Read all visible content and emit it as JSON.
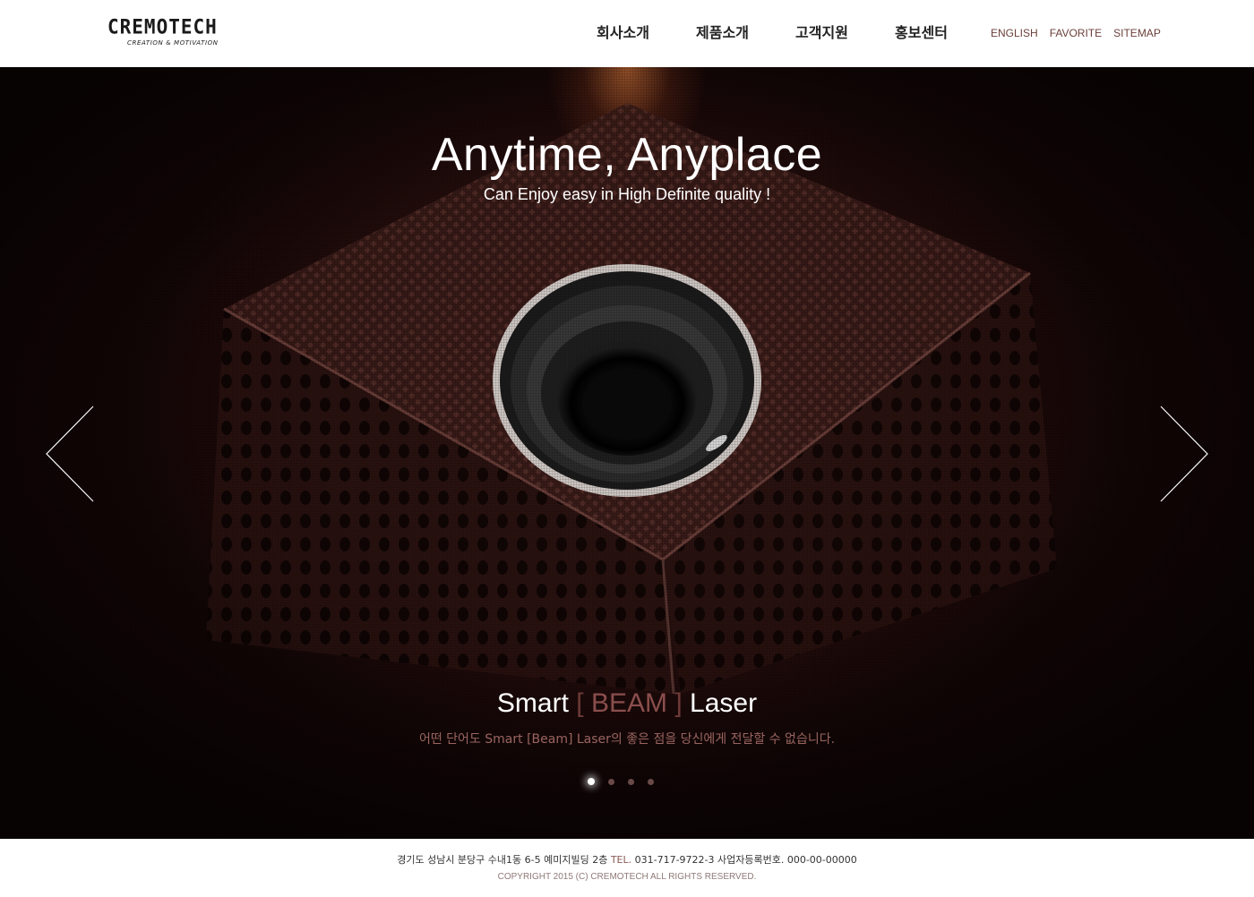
{
  "header": {
    "logo": {
      "main": "CREMOTECH",
      "tagline": "CREATION & MOTIVATION"
    },
    "nav": [
      {
        "label": "회사소개"
      },
      {
        "label": "제품소개"
      },
      {
        "label": "고객지원"
      },
      {
        "label": "홍보센터"
      }
    ],
    "util": [
      {
        "label": "ENGLISH"
      },
      {
        "label": "FAVORITE"
      },
      {
        "label": "SITEMAP"
      }
    ]
  },
  "hero": {
    "title": "Anytime, Anyplace",
    "subtitle": "Can Enjoy easy in High Definite quality !",
    "product": {
      "prefix": "Smart",
      "bracket_open": "[",
      "name": "BEAM",
      "bracket_close": "]",
      "suffix": "Laser"
    },
    "description": "어떤 단어도 Smart [Beam] Laser의 좋은 점을 당신에게 전달할 수 없습니다.",
    "slides_total": 4,
    "active_slide": 1,
    "prev_icon": "chevron-left-icon",
    "next_icon": "chevron-right-icon"
  },
  "footer": {
    "address": "경기도 성남시 분당구 수내1동 6-5 예미지빌딩 2층",
    "tel_label": "TEL.",
    "tel_and_reg": "031-717-9722-3 사업자등록번호. 000-00-00000",
    "copyright": "COPYRIGHT 2015 (C) CREMOTECH ALL RIGHTS RESERVED."
  },
  "colors": {
    "accent": "#6b3f3a",
    "hero_bg": "#1a0807",
    "beam_text": "#8a4e4c"
  }
}
